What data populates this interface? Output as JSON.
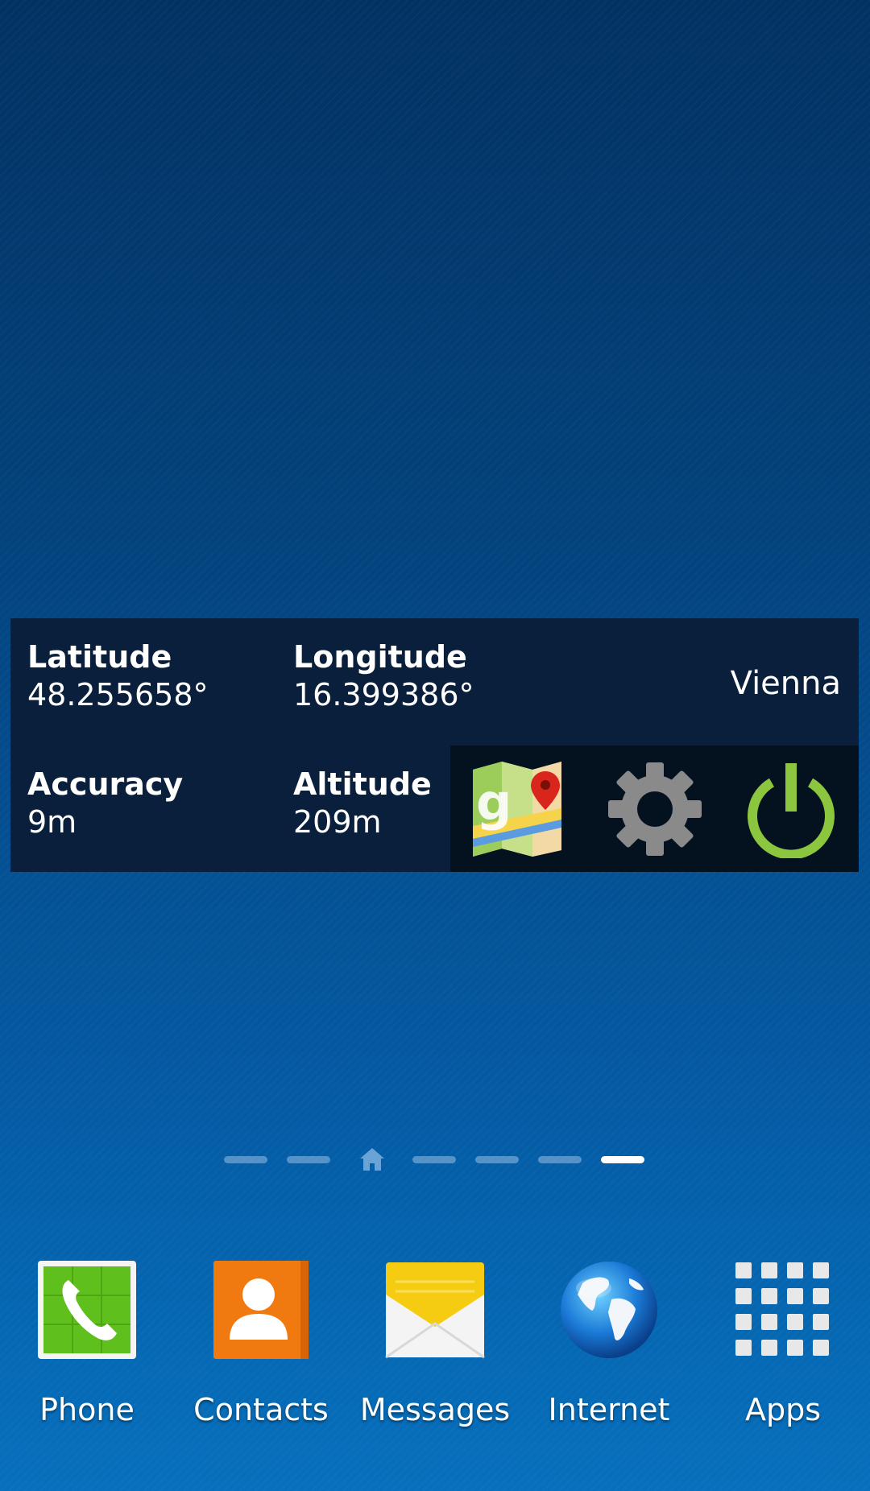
{
  "widget": {
    "latitude": {
      "label": "Latitude",
      "value": "48.255658°"
    },
    "longitude": {
      "label": "Longitude",
      "value": "16.399386°"
    },
    "accuracy": {
      "label": "Accuracy",
      "value": "9m"
    },
    "altitude": {
      "label": "Altitude",
      "value": "209m"
    },
    "city": "Vienna",
    "actions": [
      {
        "icon": "google-maps-icon"
      },
      {
        "icon": "gear-icon"
      },
      {
        "icon": "power-icon"
      }
    ],
    "colors": {
      "background": "#0a1f3b",
      "action_bar": "#04121f",
      "power_accent": "#8cc63f",
      "gear": "#8a8a8a"
    }
  },
  "page_indicator": {
    "pages": 7,
    "home_index": 2,
    "active_index": 6
  },
  "dock": {
    "items": [
      {
        "label": "Phone",
        "icon": "phone-icon"
      },
      {
        "label": "Contacts",
        "icon": "contacts-icon"
      },
      {
        "label": "Messages",
        "icon": "messages-icon"
      },
      {
        "label": "Internet",
        "icon": "globe-icon"
      },
      {
        "label": "Apps",
        "icon": "apps-grid-icon"
      }
    ]
  }
}
